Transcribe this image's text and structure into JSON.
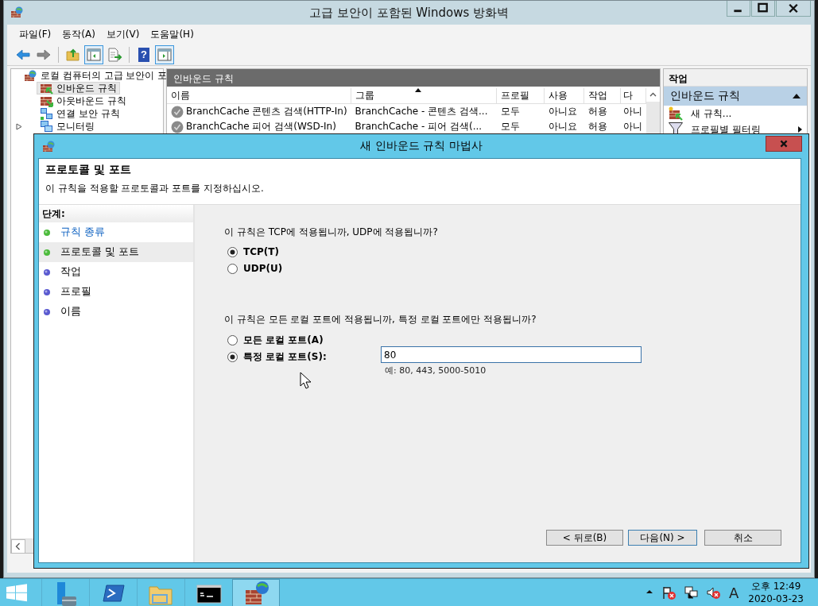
{
  "window": {
    "title": "고급 보안이 포함된 Windows 방화벽"
  },
  "menu": [
    "파일(F)",
    "동작(A)",
    "보기(V)",
    "도움말(H)"
  ],
  "toolbar": [
    {
      "kind": "back",
      "pressed": false
    },
    {
      "kind": "forward",
      "pressed": false
    },
    {
      "kind": "separator"
    },
    {
      "kind": "folder-up",
      "pressed": false
    },
    {
      "kind": "tree-pane",
      "pressed": true
    },
    {
      "kind": "export",
      "pressed": false
    },
    {
      "kind": "separator"
    },
    {
      "kind": "help",
      "pressed": false,
      "glyph": "?"
    },
    {
      "kind": "action-pane",
      "pressed": true
    }
  ],
  "tree": {
    "items": [
      {
        "label": "로컬 컴퓨터의 고급 보안이 포",
        "kind": "firewall",
        "selected": false,
        "children": [
          {
            "label": "인바운드 규칙",
            "kind": "inbound",
            "selected": true
          },
          {
            "label": "아웃바운드 규칙",
            "kind": "outbound",
            "selected": false
          },
          {
            "label": "연결 보안 규칙",
            "kind": "connection",
            "selected": false
          },
          {
            "label": "모니터링",
            "kind": "monitor",
            "selected": false,
            "expanded": false
          }
        ]
      }
    ]
  },
  "rules": {
    "title": "인바운드 규칙",
    "columns": [
      {
        "label": "이름",
        "sorted": false
      },
      {
        "label": "그룹",
        "sorted": true
      },
      {
        "label": "프로필",
        "sorted": false
      },
      {
        "label": "사용",
        "sorted": false
      },
      {
        "label": "작업",
        "sorted": false
      },
      {
        "label": "다",
        "sorted": false
      }
    ],
    "rows": [
      {
        "name": "BranchCache 콘텐츠 검색(HTTP-In)",
        "group": "BranchCache - 콘텐츠 검색...",
        "profile": "모두",
        "enabled": "아니요",
        "action": "허용",
        "column_6": "아니"
      },
      {
        "name": "BranchCache 피어 검색(WSD-In)",
        "group": "BranchCache - 피어 검색(...",
        "profile": "모두",
        "enabled": "아니요",
        "action": "허용",
        "column_6": "아니"
      }
    ]
  },
  "actions": {
    "title": "작업",
    "sections": [
      {
        "label": "인바운드 규칙",
        "expanded": true,
        "items": [
          {
            "label": "새 규칙...",
            "kind": "new-rule",
            "submenu": false
          },
          {
            "label": "프로필별 필터링",
            "kind": "filter",
            "submenu": true
          }
        ]
      }
    ]
  },
  "dialog": {
    "title": "새 인바운드 규칙 마법사",
    "heading": "프로토콜 및 포트",
    "subheading": "이 규칙을 적용할 프로토콜과 포트를 지정하십시오.",
    "steps_title": "단계:",
    "steps": [
      {
        "label": "규칙 종류",
        "completed": true,
        "selected": false
      },
      {
        "label": "프로토콜 및 포트",
        "completed": true,
        "selected": true
      },
      {
        "label": "작업",
        "completed": false,
        "selected": false
      },
      {
        "label": "프로필",
        "completed": false,
        "selected": false
      },
      {
        "label": "이름",
        "completed": false,
        "selected": false
      }
    ],
    "questions": [
      {
        "text": "이 규칙은 TCP에 적용됩니까, UDP에 적용됩니까?",
        "options": [
          {
            "label": "TCP(T)",
            "selected": true
          },
          {
            "label": "UDP(U)",
            "selected": false
          }
        ]
      },
      {
        "text": "이 규칙은 모든 로컬 포트에 적용됩니까, 특정 로컬 포트에만 적용됩니까?",
        "options": [
          {
            "label": "모든 로컬 포트(A)",
            "selected": false
          },
          {
            "label": "특정 로컬 포트(S):",
            "selected": true,
            "field": {
              "value": "80",
              "example": "예: 80, 443, 5000-5010"
            }
          }
        ]
      }
    ],
    "buttons": [
      {
        "label": "< 뒤로(B)",
        "default": false
      },
      {
        "label": "다음(N) >",
        "default": true
      },
      {
        "label": "취소",
        "default": false
      }
    ]
  },
  "taskbar": {
    "apps": [
      {
        "kind": "server-manager",
        "active": false
      },
      {
        "kind": "powershell",
        "active": false
      },
      {
        "kind": "explorer",
        "active": false
      },
      {
        "kind": "console",
        "active": false
      },
      {
        "kind": "firewall",
        "active": true
      }
    ],
    "tray": {
      "ime": "A",
      "time": "오후 12:49",
      "date": "2020-03-23"
    }
  }
}
